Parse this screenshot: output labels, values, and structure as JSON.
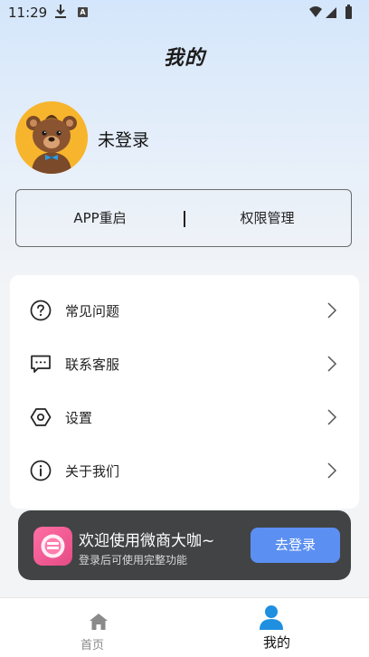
{
  "status_bar": {
    "time": "11:29",
    "notification_letter": "A"
  },
  "header": {
    "title": "我的"
  },
  "profile": {
    "username": "未登录"
  },
  "actions": {
    "restart_label": "APP重启",
    "permissions_label": "权限管理"
  },
  "menu": {
    "items": [
      {
        "label": "常见问题",
        "icon": "question-circle-icon"
      },
      {
        "label": "联系客服",
        "icon": "chat-bubble-icon"
      },
      {
        "label": "设置",
        "icon": "hexagon-settings-icon"
      },
      {
        "label": "关于我们",
        "icon": "info-circle-icon"
      }
    ]
  },
  "login_banner": {
    "title": "欢迎使用微商大咖~",
    "subtitle": "登录后可使用完整功能",
    "button_label": "去登录",
    "button_color": "#5b8ff2"
  },
  "tabbar": {
    "tabs": [
      {
        "label": "首页",
        "icon": "home-icon",
        "active": false
      },
      {
        "label": "我的",
        "icon": "user-icon",
        "active": true
      }
    ],
    "active_color": "#1f8fe0"
  }
}
